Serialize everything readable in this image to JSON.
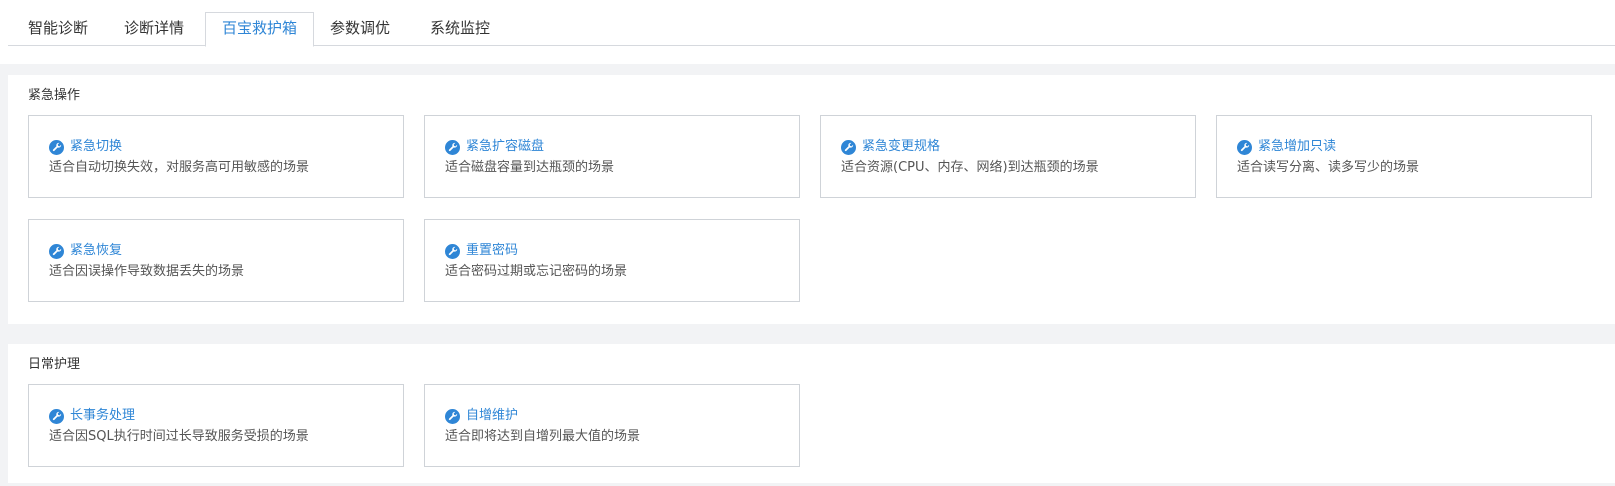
{
  "tabs": [
    {
      "label": "智能诊断",
      "active": false
    },
    {
      "label": "诊断详情",
      "active": false
    },
    {
      "label": "百宝救护箱",
      "active": true
    },
    {
      "label": "参数调优",
      "active": false
    },
    {
      "label": "系统监控",
      "active": false
    }
  ],
  "emergency": {
    "title": "紧急操作",
    "cards": [
      {
        "icon": "wrench-icon",
        "title": "紧急切换",
        "desc": "适合自动切换失效，对服务高可用敏感的场景"
      },
      {
        "icon": "wrench-icon",
        "title": "紧急扩容磁盘",
        "desc": "适合磁盘容量到达瓶颈的场景"
      },
      {
        "icon": "wrench-icon",
        "title": "紧急变更规格",
        "desc": "适合资源(CPU、内存、网络)到达瓶颈的场景"
      },
      {
        "icon": "wrench-icon",
        "title": "紧急增加只读",
        "desc": "适合读写分离、读多写少的场景"
      },
      {
        "icon": "wrench-icon",
        "title": "紧急恢复",
        "desc": "适合因误操作导致数据丢失的场景"
      },
      {
        "icon": "wrench-icon",
        "title": "重置密码",
        "desc": "适合密码过期或忘记密码的场景"
      }
    ]
  },
  "daily": {
    "title": "日常护理",
    "cards": [
      {
        "icon": "wrench-icon",
        "title": "长事务处理",
        "desc": "适合因SQL执行时间过长导致服务受损的场景"
      },
      {
        "icon": "wrench-icon",
        "title": "自增维护",
        "desc": "适合即将达到自增列最大值的场景"
      }
    ]
  },
  "colors": {
    "accent": "#2f86d6",
    "text": "#333333",
    "muted_text": "#555555",
    "background": "#f2f3f5",
    "border": "#cfd3d8"
  }
}
